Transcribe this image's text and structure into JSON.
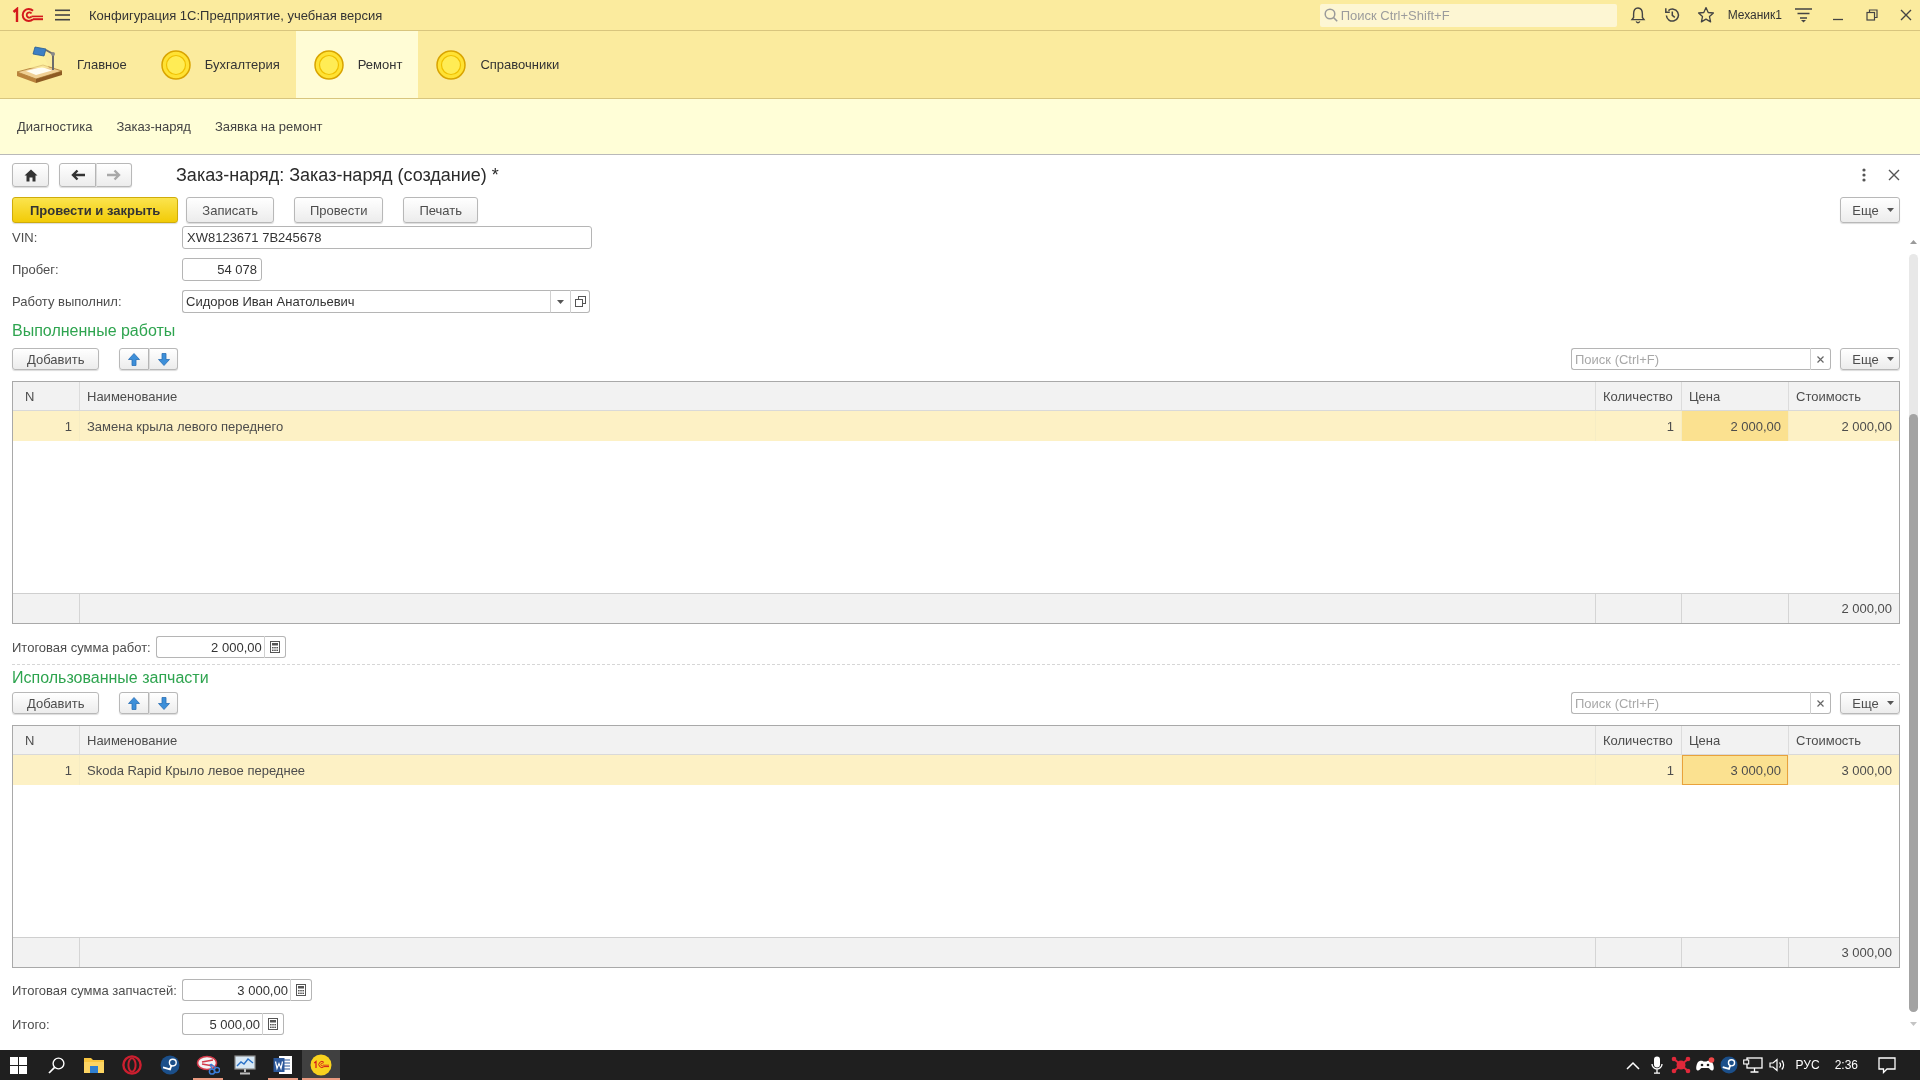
{
  "app_bar": {
    "title": "Конфигурация 1С:Предприятие, учебная версия",
    "search": {
      "placeholder": "Поиск Ctrl+Shift+F"
    },
    "user": "Механик1"
  },
  "sections": [
    {
      "kind": "desk",
      "label": "Главное",
      "selected": false
    },
    {
      "kind": "circle",
      "label": "Бухгалтерия",
      "selected": false
    },
    {
      "kind": "circle",
      "label": "Ремонт",
      "selected": true
    },
    {
      "kind": "circle",
      "label": "Справочники",
      "selected": false
    }
  ],
  "subsections": [
    "Диагностика",
    "Заказ-наряд",
    "Заявка на ремонт"
  ],
  "form": {
    "navigation": [
      {
        "kind": "back",
        "disabled": false
      },
      {
        "kind": "forward",
        "disabled": true
      }
    ],
    "title": "Заказ-наряд: Заказ-наряд (создание) *",
    "commands": [
      {
        "label": "Провести и закрыть",
        "default": true
      },
      {
        "label": "Записать",
        "default": false
      },
      {
        "label": "Провести",
        "default": false
      },
      {
        "label": "Печать",
        "default": false
      }
    ],
    "more": "Еще",
    "fields": [
      {
        "kind": "text",
        "label": "VIN:",
        "value": "XW8123671 7B245678"
      },
      {
        "kind": "number",
        "label": "Пробег:",
        "value": "54 078"
      },
      {
        "kind": "choice",
        "label": "Работу выполнил:",
        "value": "Сидоров Иван Анатольевич"
      }
    ]
  },
  "tables": [
    {
      "title": "Выполненные работы",
      "add": "Добавить",
      "search": {
        "placeholder": "Поиск (Ctrl+F)"
      },
      "more": "Еще",
      "focused": false,
      "columns": [
        "N",
        "Наименование",
        "Количество",
        "Цена",
        "Стоимость"
      ],
      "rows": [
        {
          "selected": true,
          "cells": [
            {
              "text": "1",
              "current": false
            },
            {
              "text": "Замена крыла левого переднего",
              "current": false
            },
            {
              "text": "1",
              "current": false
            },
            {
              "text": "2 000,00",
              "current": true
            },
            {
              "text": "2 000,00",
              "current": false
            }
          ]
        }
      ],
      "footer_total": "2 000,00",
      "total": {
        "label": "Итоговая сумма работ:",
        "value": "2 000,00"
      }
    },
    {
      "title": "Использованные запчасти",
      "add": "Добавить",
      "search": {
        "placeholder": "Поиск (Ctrl+F)"
      },
      "more": "Еще",
      "focused": true,
      "columns": [
        "N",
        "Наименование",
        "Количество",
        "Цена",
        "Стоимость"
      ],
      "rows": [
        {
          "selected": true,
          "cells": [
            {
              "text": "1",
              "current": false
            },
            {
              "text": "Skoda Rapid Крыло левое переднее",
              "current": false
            },
            {
              "text": "1",
              "current": false
            },
            {
              "text": "3 000,00",
              "current": true
            },
            {
              "text": "3 000,00",
              "current": false
            }
          ]
        }
      ],
      "footer_total": "3 000,00",
      "total": {
        "label": "Итоговая сумма запчастей:",
        "value": "3 000,00"
      }
    }
  ],
  "grand_total": {
    "label": "Итого:",
    "value": "5 000,00"
  },
  "taskbar": {
    "apps": [
      {
        "kind": "folder",
        "running": false,
        "selected": false
      },
      {
        "kind": "ring",
        "running": false,
        "selected": false
      },
      {
        "kind": "disc",
        "running": false,
        "selected": false
      },
      {
        "kind": "scissors",
        "running": true,
        "selected": false
      },
      {
        "kind": "monitor",
        "running": false,
        "selected": false
      },
      {
        "kind": "document",
        "running": true,
        "selected": false
      },
      {
        "kind": "logo",
        "running": true,
        "selected": true
      }
    ],
    "language": "РУС",
    "time": "2:36"
  }
}
